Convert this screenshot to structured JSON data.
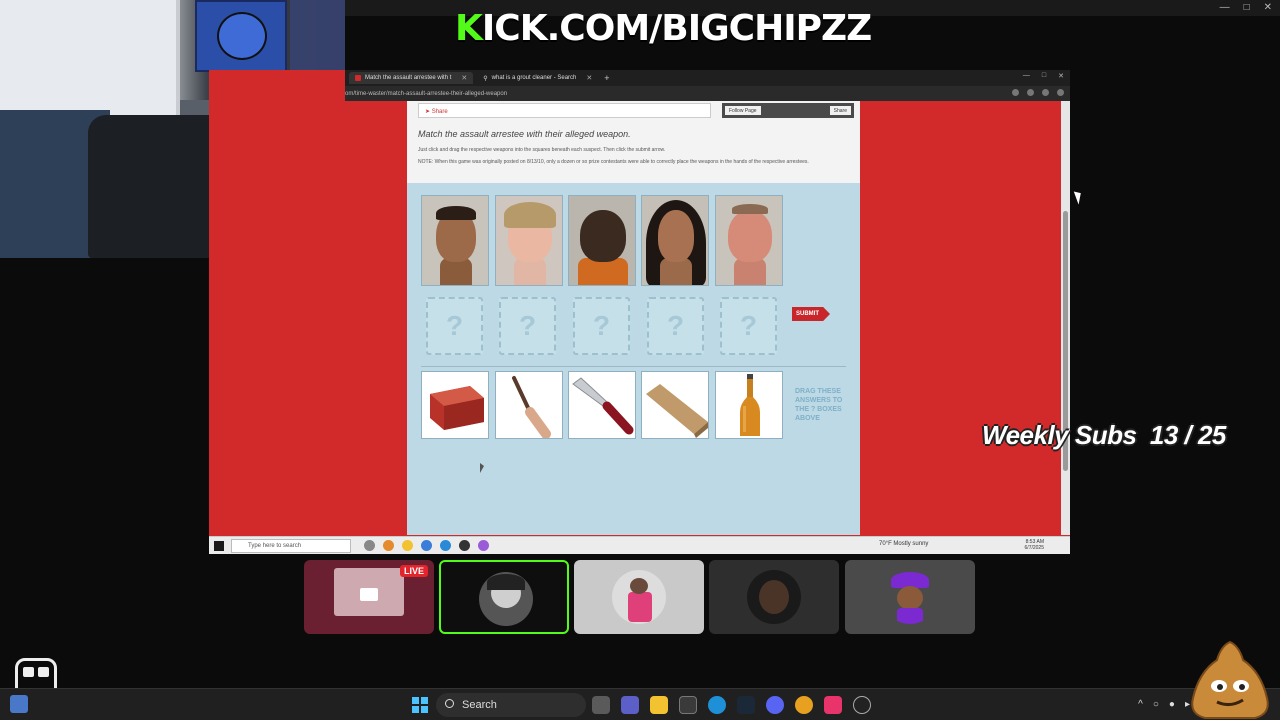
{
  "banner": {
    "prefix": "K",
    "rest": "ICK.COM/BIGCHIPZZ"
  },
  "browser": {
    "tabs": [
      {
        "label": "Match the assault arrestee with t",
        "active": true
      },
      {
        "label": "what is a grout cleaner - Search",
        "active": false
      }
    ],
    "address": "om/time-waster/match-assault-arrestee-their-alleged-weapon"
  },
  "page": {
    "share_label": "Share",
    "follow_label": "Follow Page",
    "fb_share_label": "Share",
    "title": "Match the assault arrestee with their alleged weapon.",
    "instructions": "Just click and drag the respective weapons into the squares beneath each suspect. Then click the submit arrow.",
    "note": "NOTE: When this game was originally posted on 8/13/10, only a dozen or so prize contestants were able to correctly place the weapons in the hands of the respective arrestees.",
    "slot_glyph": "?",
    "submit_label": "SUBMIT",
    "drag_hint": "DRAG THESE ANSWERS TO THE ? BOXES ABOVE",
    "suspects": [
      {
        "name": "suspect-1"
      },
      {
        "name": "suspect-2"
      },
      {
        "name": "suspect-3"
      },
      {
        "name": "suspect-4"
      },
      {
        "name": "suspect-5"
      }
    ],
    "weapons": [
      {
        "icon": "brick-icon"
      },
      {
        "icon": "bat-icon"
      },
      {
        "icon": "knife-icon"
      },
      {
        "icon": "board-icon"
      },
      {
        "icon": "beer-bottle-icon"
      }
    ]
  },
  "inner_taskbar": {
    "search_placeholder": "Type here to search",
    "weather": "70°F  Mostly sunny",
    "time": "8:53 AM",
    "date": "6/7/2025"
  },
  "overlay": {
    "weekly_subs": "Weekly Subs  13 / 25"
  },
  "participants": [
    {
      "live_label": "LIVE"
    }
  ],
  "host_taskbar": {
    "search_label": "Search"
  },
  "colors": {
    "kick_green": "#53fc18",
    "page_red": "#d22a2a",
    "page_blue": "#bcd9e5",
    "submit_red": "#c8262b"
  }
}
